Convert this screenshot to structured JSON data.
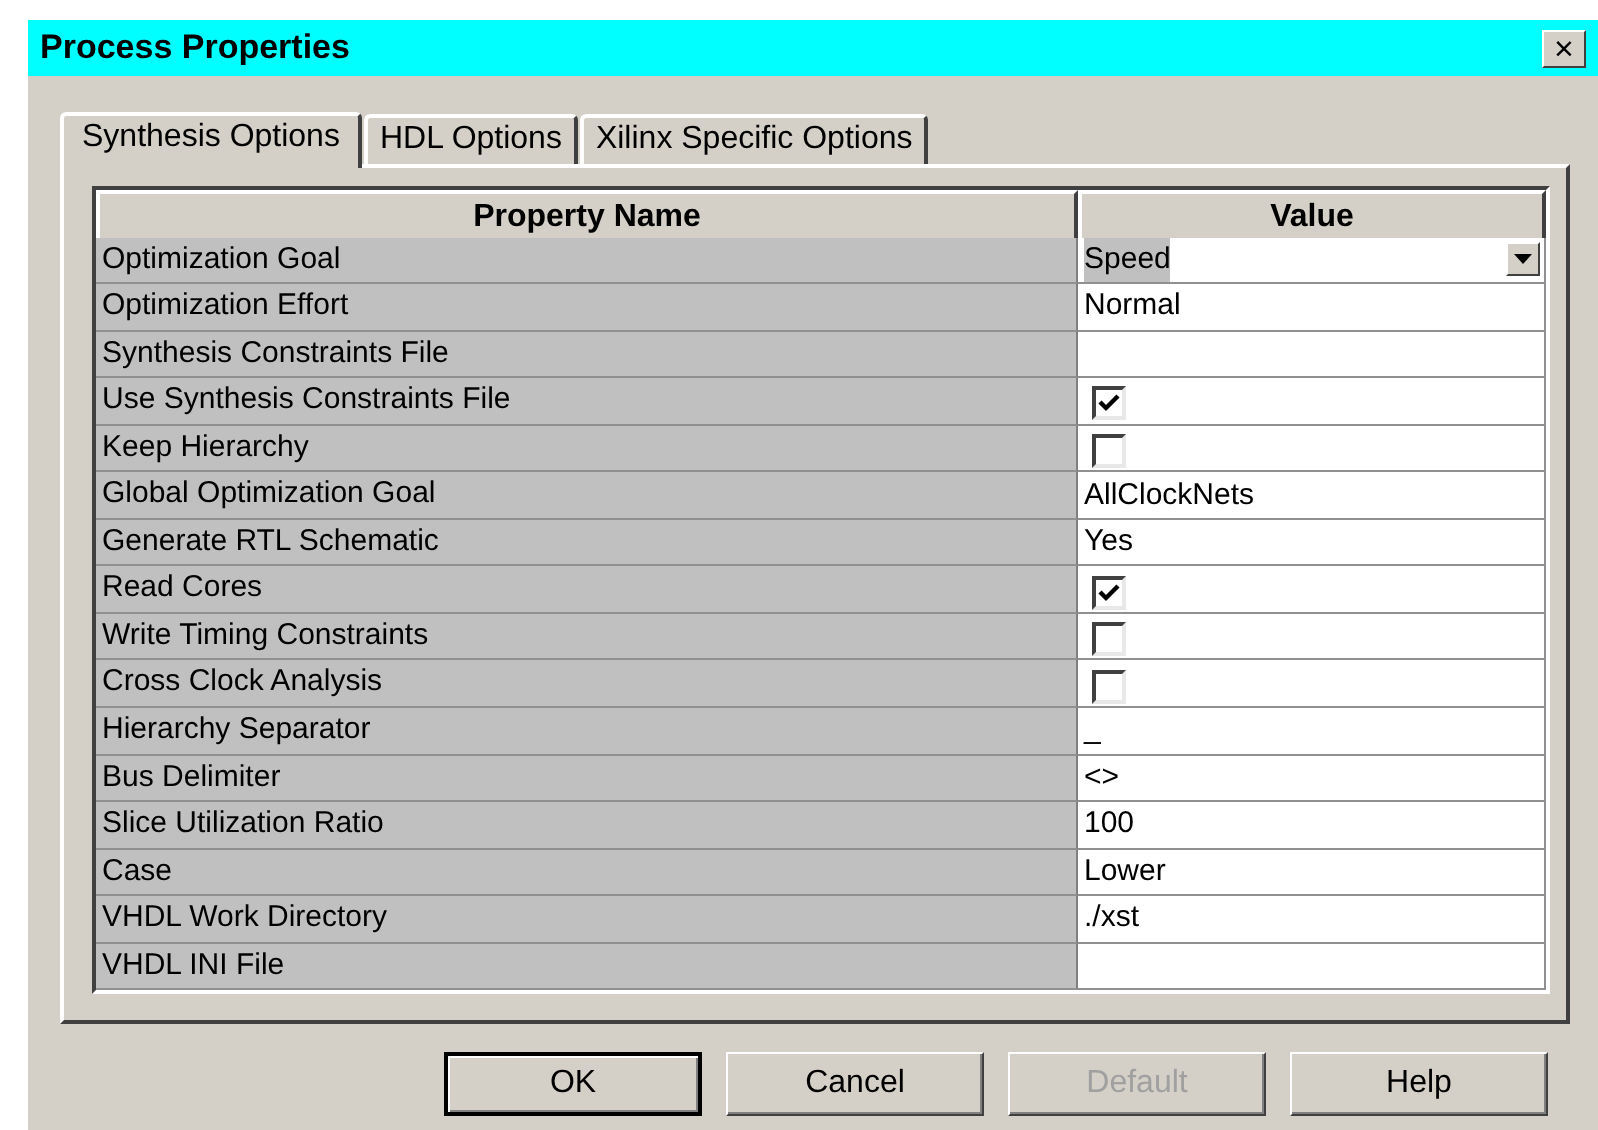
{
  "window": {
    "title": "Process Properties",
    "close": "×"
  },
  "tabs": [
    {
      "label": "Synthesis Options",
      "selected": true
    },
    {
      "label": "HDL Options",
      "selected": false
    },
    {
      "label": "Xilinx Specific Options",
      "selected": false
    }
  ],
  "table": {
    "columns": [
      "Property Name",
      "Value"
    ],
    "rows": [
      {
        "name": "Optimization Goal",
        "kind": "dropdown",
        "value": "Speed"
      },
      {
        "name": "Optimization Effort",
        "kind": "text",
        "value": "Normal"
      },
      {
        "name": "Synthesis Constraints File",
        "kind": "text"
      },
      {
        "name": "Use Synthesis Constraints File",
        "kind": "checkbox",
        "checked": true
      },
      {
        "name": "Keep Hierarchy",
        "kind": "checkbox",
        "checked": false
      },
      {
        "name": "Global Optimization Goal",
        "kind": "text",
        "value": "AllClockNets"
      },
      {
        "name": "Generate RTL Schematic",
        "kind": "text",
        "value": "Yes"
      },
      {
        "name": "Read Cores",
        "kind": "checkbox",
        "checked": true
      },
      {
        "name": "Write Timing Constraints",
        "kind": "checkbox",
        "checked": false
      },
      {
        "name": "Cross Clock Analysis",
        "kind": "checkbox",
        "checked": false
      },
      {
        "name": "Hierarchy Separator",
        "kind": "text",
        "value": "_"
      },
      {
        "name": "Bus Delimiter",
        "kind": "text",
        "value": "<>"
      },
      {
        "name": "Slice Utilization Ratio",
        "kind": "text",
        "value": "100"
      },
      {
        "name": "Case",
        "kind": "text",
        "value": "Lower"
      },
      {
        "name": "VHDL Work Directory",
        "kind": "text",
        "value": "./xst"
      },
      {
        "name": "VHDL INI File",
        "kind": "text"
      }
    ]
  },
  "buttons": [
    {
      "label": "OK",
      "default": true,
      "disabled": false
    },
    {
      "label": "Cancel",
      "default": false,
      "disabled": false
    },
    {
      "label": "Default",
      "default": false,
      "disabled": true
    },
    {
      "label": "Help",
      "default": false,
      "disabled": false
    }
  ]
}
